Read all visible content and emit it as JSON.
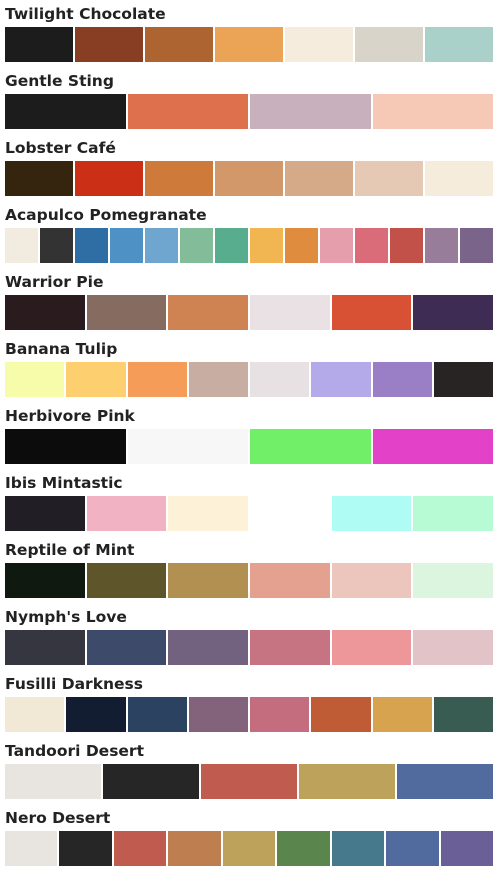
{
  "palettes": [
    {
      "name": "Twilight Chocolate",
      "colors": [
        "#1c1c1c",
        "#873e23",
        "#ad6430",
        "#eba355",
        "#f6ecde",
        "#d8d4c9",
        "#a9d0c9"
      ]
    },
    {
      "name": "Gentle Sting",
      "colors": [
        "#1c1c1c",
        "#de704d",
        "#c9b0bd",
        "#f6c9b6"
      ]
    },
    {
      "name": "Lobster Café",
      "colors": [
        "#35250f",
        "#cb3016",
        "#cd7a3b",
        "#d2986a",
        "#d5aa89",
        "#e5c9b4",
        "#f6ecdc"
      ]
    },
    {
      "name": "Acapulco Pomegranate",
      "colors": [
        "#f1ebe0",
        "#333333",
        "#2f6ea5",
        "#4d91c5",
        "#6fa6cf",
        "#83bc98",
        "#58ad8e",
        "#f1b551",
        "#e08c3e",
        "#e59eac",
        "#d96c78",
        "#c25249",
        "#977d99",
        "#7b6489"
      ]
    },
    {
      "name": "Warrior Pie",
      "colors": [
        "#2a1b1f",
        "#856b60",
        "#cf8252",
        "#e9e1e3",
        "#d95135",
        "#3e2c55"
      ]
    },
    {
      "name": "Banana Tulip",
      "colors": [
        "#f6fca9",
        "#fdcf6f",
        "#f59d58",
        "#c8aea2",
        "#e8e1e3",
        "#b4aae9",
        "#9a7fc6",
        "#272423"
      ]
    },
    {
      "name": "Herbivore Pink",
      "colors": [
        "#0c0c0c",
        "#f7f7f7",
        "#71ef69",
        "#e341c7"
      ]
    },
    {
      "name": "Ibis Mintastic",
      "colors": [
        "#211e26",
        "#f1b2c3",
        "#fdf2d8",
        "#ffffff",
        "#aefcf4",
        "#b7fbd5"
      ]
    },
    {
      "name": "Reptile of Mint",
      "colors": [
        "#101910",
        "#5f552b",
        "#b29052",
        "#e4a190",
        "#ecc6bd",
        "#dbf5df"
      ]
    },
    {
      "name": "Nymph's Love",
      "colors": [
        "#363640",
        "#3e4a69",
        "#72627f",
        "#c77482",
        "#ed979a",
        "#e1c3c8"
      ]
    },
    {
      "name": "Fusilli Darkness",
      "colors": [
        "#f1e8d6",
        "#121d32",
        "#2b4260",
        "#83637c",
        "#c46d7f",
        "#bf5b35",
        "#d7a34f",
        "#385c51"
      ]
    },
    {
      "name": "Tandoori Desert",
      "colors": [
        "#e8e4df",
        "#262626",
        "#bf5b4f",
        "#bca25b",
        "#526b9e"
      ]
    },
    {
      "name": "Nero Desert",
      "colors": [
        "#e8e4df",
        "#262626",
        "#bf5b4f",
        "#be7e50",
        "#bca25b",
        "#5a854d",
        "#47798d",
        "#526b9e",
        "#6a5f96"
      ]
    }
  ]
}
